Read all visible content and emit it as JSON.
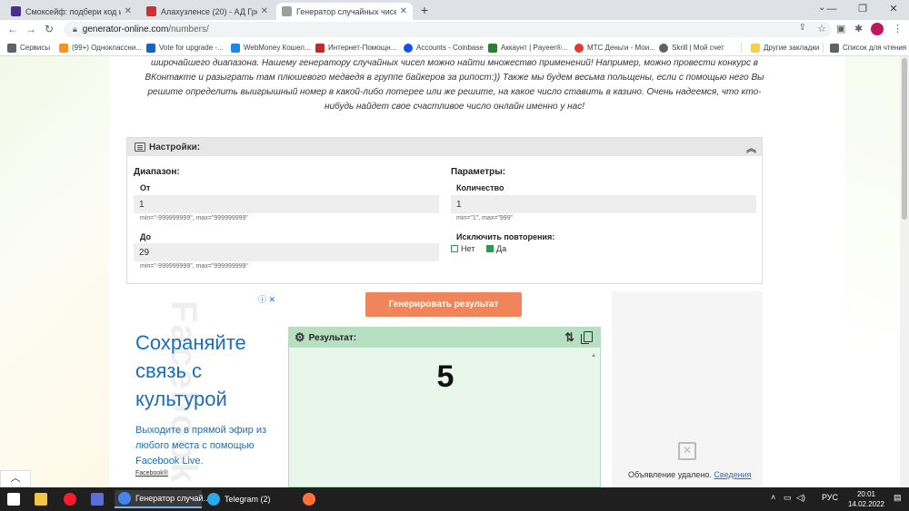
{
  "browser": {
    "tabs": [
      {
        "title": "Смоксейф: подбери код и полу",
        "color": "#4a2d8c"
      },
      {
        "title": "Алахузленсе (20) - АД Гресия (",
        "color": "#d32f2f"
      },
      {
        "title": "Генератор случайных чисел он",
        "color": "#9e9e9e"
      }
    ],
    "new_tab": "+",
    "window_buttons": [
      "—",
      "❐",
      "✕"
    ],
    "url_host": "generator-online.com",
    "url_path": "/numbers/",
    "bookmarks": [
      {
        "label": "Сервисы",
        "color": "#5f6368"
      },
      {
        "label": "(99+) Одноклассни...",
        "color": "#f7931e"
      },
      {
        "label": "Vote for upgrade -...",
        "color": "#1565c0"
      },
      {
        "label": "WebMoney Кошел...",
        "color": "#1e88e5"
      },
      {
        "label": "Интернет-Помощн...",
        "color": "#c62828"
      },
      {
        "label": "Accounts - Coinbase",
        "color": "#1652f0"
      },
      {
        "label": "Аккаунт | Payeer®...",
        "color": "#2e7d32"
      },
      {
        "label": "МТС Деньги - Мои...",
        "color": "#e53935"
      },
      {
        "label": "Skrill | Мой счет",
        "color": "#616161"
      },
      {
        "label": "Другие закладки",
        "color": "#f9ce4b"
      },
      {
        "label": "Список для чтения",
        "color": "#5f6368"
      }
    ]
  },
  "page": {
    "intro": "широчайшего диапазона. Нашему генератору случайных чисел можно найти множество применений! Например, можно провести конкурс в ВКонтакте и разыграть там плюшевого медведя в группе байкеров за рипост:)) Также мы будем весьма польщены, если с помощью него Вы решите определить выигрышный номер в какой-либо лотерее или же решите, на какое число ставить в казино. Очень надеемся, что кто-нибудь найдет свое счастливое число онлайн именно у нас!",
    "settings_title": "Настройки:",
    "range_title": "Диапазон:",
    "from_label": "От",
    "from_value": "1",
    "from_hint": "min=\"-999999999\", max=\"999999999\"",
    "to_label": "До",
    "to_value": "29",
    "to_hint": "min=\"-999999999\", max=\"999999999\"",
    "params_title": "Параметры:",
    "count_label": "Количество",
    "count_value": "1",
    "count_hint": "min=\"1\", max=\"999\"",
    "exclude_label": "Исключить повторения:",
    "option_no": "Нет",
    "option_yes": "Да",
    "generate_button": "Генерировать результат",
    "result_title": "Результат:",
    "result_value": "5"
  },
  "ad_left": {
    "watermark": "Facebook",
    "big_text": "Сохраняйте связь с культурой",
    "small_text": "Выходите в прямой эфир из любого места с помощью Facebook Live.",
    "brand": "Facebook®"
  },
  "ad_right": {
    "removed_text": "Объявление удалено.",
    "details_link": "Сведения"
  },
  "taskbar": {
    "apps": [
      {
        "label": "Генератор случай...",
        "color": "#4285f4"
      },
      {
        "label": "Telegram (2)",
        "color": "#29a9eb"
      }
    ],
    "lang": "РУС",
    "time": "20:01",
    "date": "14.02.2022"
  }
}
